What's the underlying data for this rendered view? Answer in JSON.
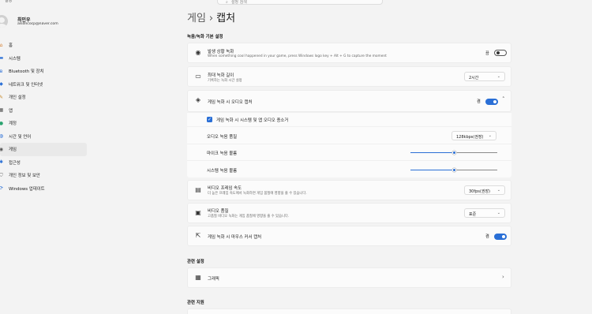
{
  "topbar": {
    "cut_text": "설정"
  },
  "search": {
    "placeholder": "설정 검색",
    "icon": "search-icon"
  },
  "profile": {
    "name": "최민우",
    "email": "alsdncocp@naver.com"
  },
  "sidebar": {
    "items": [
      {
        "label": "홈",
        "icon": "home-icon"
      },
      {
        "label": "시스템",
        "icon": "monitor-icon"
      },
      {
        "label": "Bluetooth 및 장치",
        "icon": "bluetooth-icon"
      },
      {
        "label": "네트워크 및 인터넷",
        "icon": "wifi-icon"
      },
      {
        "label": "개인 설정",
        "icon": "brush-icon"
      },
      {
        "label": "앱",
        "icon": "apps-icon"
      },
      {
        "label": "계정",
        "icon": "person-icon"
      },
      {
        "label": "시간 및 언어",
        "icon": "globe-clock-icon"
      },
      {
        "label": "게임",
        "icon": "gamepad-icon"
      },
      {
        "label": "접근성",
        "icon": "accessibility-icon"
      },
      {
        "label": "개인 정보 및 보안",
        "icon": "shield-icon"
      },
      {
        "label": "Windows 업데이트",
        "icon": "update-icon"
      }
    ],
    "active_index": 8
  },
  "page": {
    "crumb_parent": "게임",
    "crumb_sep": "›",
    "crumb_current": "캡처"
  },
  "recording": {
    "section_title": "녹음/녹화 기본 설정",
    "background_record": {
      "title": "발생 상황 녹화",
      "desc": "When something cool happened in your game, press Windows logo key + Alt + G to capture the moment",
      "state_label": "끔",
      "on": false
    },
    "max_length": {
      "title": "최대 녹화 길이",
      "desc": "기록하는 녹화 시간 설정",
      "value": "2시간"
    },
    "audio": {
      "title": "게임 녹화 시 오디오 캡처",
      "state_label": "켬",
      "on": true,
      "capture_system": {
        "label": "게임 녹화 시 시스템 및 앱 오디오 종소거",
        "checked": true
      },
      "quality": {
        "label": "오디오 녹음 품질",
        "value": "128kbps(권장)"
      },
      "mic_volume": {
        "label": "마이크 녹음 볼륨",
        "level": 0.5
      },
      "system_volume": {
        "label": "시스템 녹음 볼륨",
        "level": 0.5
      }
    },
    "frame_rate": {
      "title": "비디오 프레임 속도",
      "desc": "더 높은 프레임 속도에서 녹화하면 게임 품질에 영향을 줄 수 있습니다.",
      "value": "30fps(권장)"
    },
    "video_quality": {
      "title": "비디오 품질",
      "desc": "고품질 비디오 녹화는 게임 품질에 영향을 줄 수 있습니다.",
      "value": "표준"
    },
    "mouse_cursor": {
      "title": "게임 녹화 시 마우스 커서 캡처",
      "state_label": "켬",
      "on": true
    }
  },
  "related_settings": {
    "section_title": "관련 설정",
    "graphics": {
      "label": "그래픽"
    }
  },
  "related_support": {
    "section_title": "관련 지원"
  },
  "colors": {
    "accent": "#2a6fd6",
    "background": "#f3f3f3",
    "card": "#fbfbfb"
  }
}
